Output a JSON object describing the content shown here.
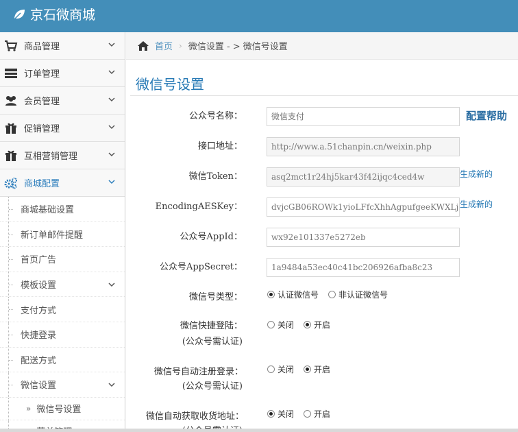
{
  "app": {
    "title": "京石微商城"
  },
  "sidebar": {
    "items": [
      {
        "label": "商品管理",
        "icon": "cart-icon"
      },
      {
        "label": "订单管理",
        "icon": "list-icon"
      },
      {
        "label": "会员管理",
        "icon": "users-icon"
      },
      {
        "label": "促销管理",
        "icon": "gift-icon"
      },
      {
        "label": "互相营销管理",
        "icon": "gift-icon"
      },
      {
        "label": "商城配置",
        "icon": "cogs-icon"
      }
    ],
    "sub_items": [
      {
        "label": "商城基础设置"
      },
      {
        "label": "新订单邮件提醒"
      },
      {
        "label": "首页广告"
      },
      {
        "label": "模板设置"
      },
      {
        "label": "支付方式"
      },
      {
        "label": "快捷登录"
      },
      {
        "label": "配送方式"
      },
      {
        "label": "微信设置"
      }
    ],
    "sub_sub_items": [
      {
        "label": "微信号设置",
        "arrows": "»"
      },
      {
        "label": "菜单管理",
        "arrows": "»"
      }
    ]
  },
  "breadcrumb": {
    "home": "首页",
    "current": "微信设置 - > 微信号设置"
  },
  "page": {
    "title": "微信号设置",
    "help": "配置帮助"
  },
  "form": {
    "name_label": "公众号名称：",
    "name_placeholder": "微信支付",
    "url_label": "接口地址：",
    "url_value": "http://www.a.51chanpin.cn/weixin.php",
    "token_label": "微信Token：",
    "token_value": "asq2mct1r24hj5kar43f42ijqc4ced4w",
    "token_regen": "生成新的",
    "aes_label": "EncodingAESKey：",
    "aes_value": "dvjcGB06ROWk1yioLFfcXhhAgpufgeeKWXLj",
    "aes_regen": "生成新的",
    "appid_label": "公众号AppId：",
    "appid_value": "wx92e101337e5272eb",
    "secret_label": "公众号AppSecret：",
    "secret_value": "1a9484a53ec40c41bc206926afba8c23",
    "type_label": "微信号类型：",
    "type_opt1": "认证微信号",
    "type_opt2": "非认证微信号",
    "quick_label": "微信快捷登陆：",
    "quick_note": "(公众号需认证)",
    "auto_label": "微信号自动注册登录：",
    "auto_note": "(公众号需认证)",
    "addr_label": "微信自动获取收货地址：",
    "addr_note": "(公众号需认证)",
    "off": "关闭",
    "on": "开启"
  }
}
